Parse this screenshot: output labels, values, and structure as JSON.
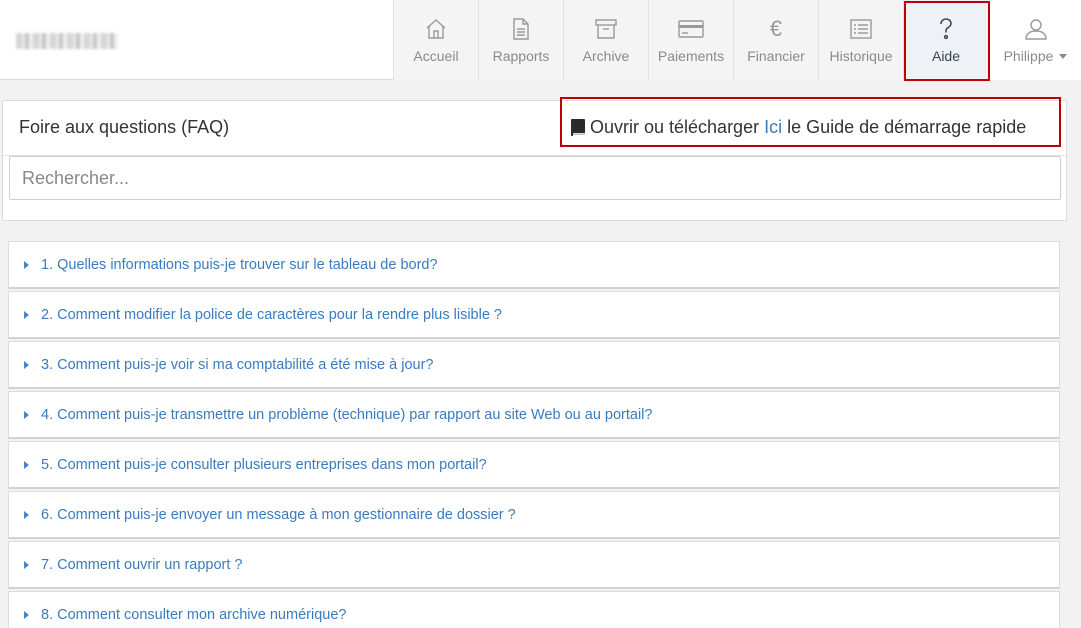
{
  "nav": {
    "items": [
      {
        "label": "Accueil",
        "icon": "home-icon"
      },
      {
        "label": "Rapports",
        "icon": "document-icon"
      },
      {
        "label": "Archive",
        "icon": "archive-icon"
      },
      {
        "label": "Paiements",
        "icon": "credit-card-icon"
      },
      {
        "label": "Financier",
        "icon": "euro-icon"
      },
      {
        "label": "Historique",
        "icon": "list-icon"
      },
      {
        "label": "Aide",
        "icon": "question-icon"
      }
    ],
    "user": "Philippe",
    "active_color": "#3a4450",
    "highlight_color": "#c00000"
  },
  "faq": {
    "title": "Foire aux questions (FAQ)",
    "guide_prefix": "Ouvrir ou télécharger",
    "guide_link": "Ici",
    "guide_suffix": "le Guide de démarrage rapide",
    "search_placeholder": "Rechercher...",
    "link_color": "#3a7bbf",
    "questions": [
      "1. Quelles informations puis-je trouver sur le tableau de bord?",
      "2. Comment modifier la police de caractères pour la rendre plus lisible ?",
      "3. Comment puis-je voir si ma comptabilité a été mise à jour?",
      "4. Comment puis-je transmettre un problème (technique) par rapport au site Web ou au portail?",
      "5. Comment puis-je consulter plusieurs entreprises dans mon portail?",
      "6. Comment puis-je envoyer un message à mon gestionnaire de dossier ?",
      "7. Comment ouvrir un rapport ?",
      "8. Comment consulter mon archive numérique?"
    ]
  }
}
